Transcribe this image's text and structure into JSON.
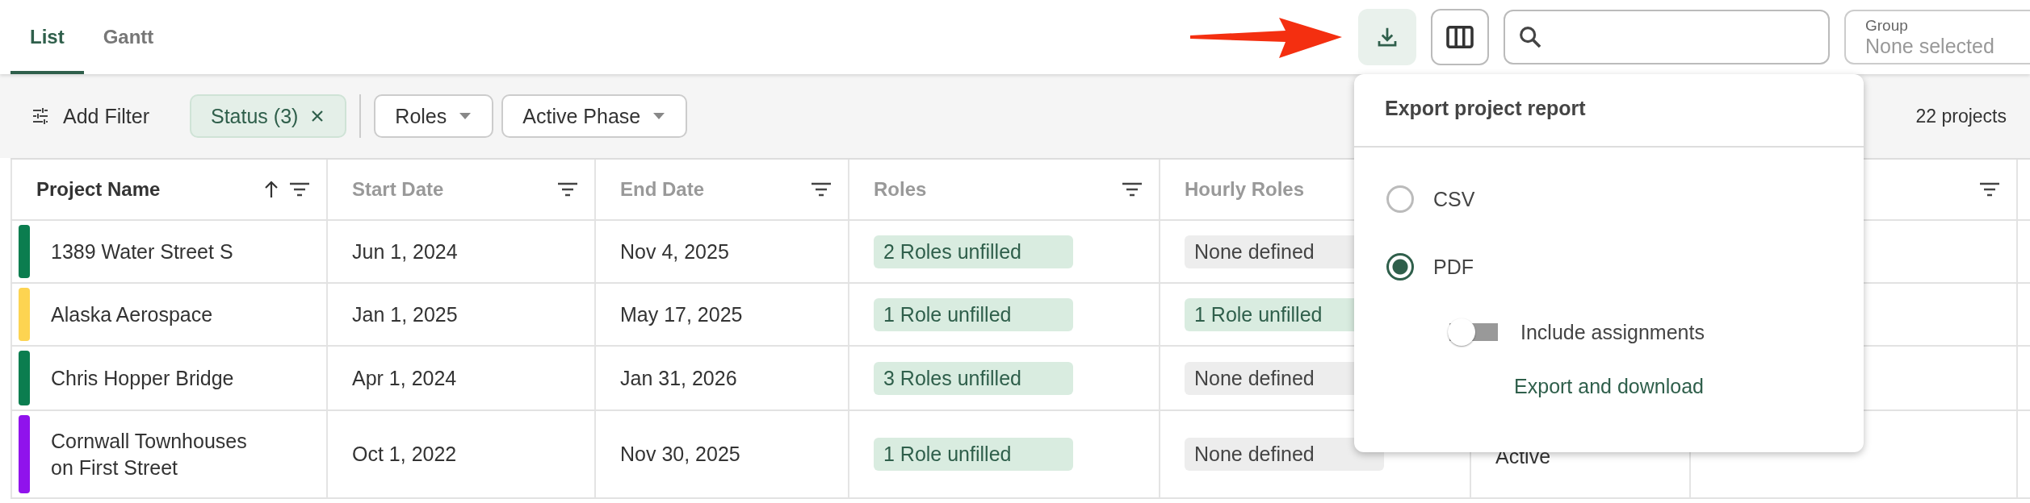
{
  "tabs": [
    {
      "label": "List",
      "selected": true
    },
    {
      "label": "Gantt",
      "selected": false
    }
  ],
  "group_select": {
    "label": "Group",
    "placeholder": "None selected"
  },
  "filters": {
    "add_filter": "Add Filter",
    "chips": [
      {
        "kind": "active",
        "label": "Status (3)"
      },
      {
        "kind": "dropdown",
        "label": "Roles"
      },
      {
        "kind": "dropdown",
        "label": "Active Phase"
      }
    ],
    "count": "22 projects"
  },
  "table": {
    "columns": [
      {
        "label": "Project Name",
        "sorted": true,
        "filter": true
      },
      {
        "label": "Start Date",
        "sorted": false,
        "filter": true
      },
      {
        "label": "End Date",
        "sorted": false,
        "filter": true
      },
      {
        "label": "Roles",
        "sorted": false,
        "filter": true
      },
      {
        "label": "Hourly Roles"
      },
      {},
      {
        "sorted": false,
        "filter": true
      },
      {}
    ],
    "rows": [
      {
        "color": "#0b7d4f",
        "name": "1389 Water Street S",
        "start": "Jun 1, 2024",
        "end": "Nov 4, 2025",
        "roles": {
          "kind": "unfilled",
          "text": "2 Roles unfilled"
        },
        "hourly_roles": {
          "kind": "none",
          "text": "None defined"
        }
      },
      {
        "color": "#fdd451",
        "name": "Alaska Aerospace",
        "start": "Jan 1, 2025",
        "end": "May 17, 2025",
        "roles": {
          "kind": "unfilled",
          "text": "1 Role unfilled"
        },
        "hourly_roles": {
          "kind": "unfilled",
          "text": "1 Role unfilled"
        }
      },
      {
        "color": "#0b7d4f",
        "name": "Chris Hopper Bridge",
        "start": "Apr 1, 2024",
        "end": "Jan 31, 2026",
        "roles": {
          "kind": "unfilled",
          "text": "3 Roles unfilled"
        },
        "hourly_roles": {
          "kind": "none",
          "text": "None defined"
        }
      },
      {
        "color": "#9013ec",
        "name": "Cornwall Townhouses on First Street",
        "start": "Oct 1, 2022",
        "end": "Nov 30, 2025",
        "roles": {
          "kind": "unfilled",
          "text": "1 Role unfilled"
        },
        "hourly_roles": {
          "kind": "none",
          "text": "None defined"
        },
        "column_6": "Active"
      }
    ]
  },
  "export_menu": {
    "title": "Export project report",
    "options": [
      {
        "label": "CSV",
        "selected": false
      },
      {
        "label": "PDF",
        "selected": true
      }
    ],
    "toggle": {
      "label": "Include assignments",
      "on": false
    },
    "action": "Export and download"
  }
}
